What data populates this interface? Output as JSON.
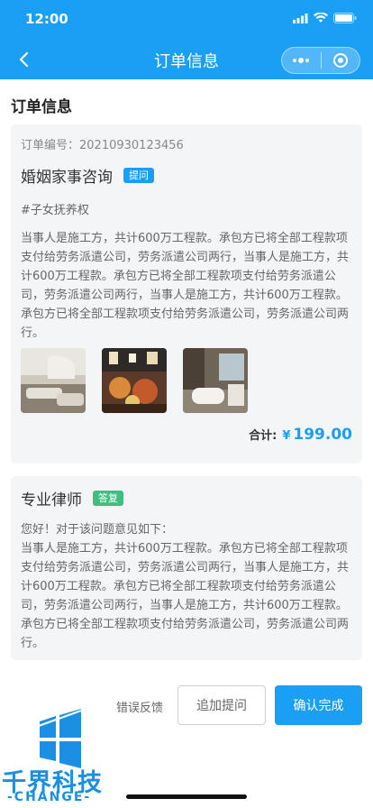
{
  "status": {
    "time": "12:00"
  },
  "nav": {
    "title": "订单信息"
  },
  "section": {
    "title": "订单信息"
  },
  "order": {
    "number_text": "订单编号：20210930123456",
    "category": "婚姻家事咨询",
    "badge": "提问",
    "tag": "#子女抚养权",
    "content": "当事人是施工方，共计600万工程款。承包方已将全部工程款项支付给劳务派遣公司，劳务派遣公司两行，当事人是施工方，共计600万工程款。承包方已将全部工程款项支付给劳务派遣公司，劳务派遣公司两行，当事人是施工方，共计600万工程款。承包方已将全部工程款项支付给劳务派遣公司，劳务派遣公司两行。",
    "total_label": "合计:",
    "currency": "¥",
    "amount": "199.00"
  },
  "answer": {
    "title": "专业律师",
    "badge": "答复",
    "greeting": "您好！对于该问题意见如下：",
    "content": "当事人是施工方，共计600万工程款。承包方已将全部工程款项支付给劳务派遣公司，劳务派遣公司两行，当事人是施工方，共计600万工程款。承包方已将全部工程款项支付给劳务派遣公司，劳务派遣公司两行，当事人是施工方，共计600万工程款。承包方已将全部工程款项支付给劳务派遣公司，劳务派遣公司两行。"
  },
  "actions": {
    "feedback": "错误反馈",
    "add_question": "追加提问",
    "confirm": "确认完成"
  },
  "watermark": {
    "text": "千界科技",
    "sub": "-CHANGE-"
  },
  "colors": {
    "primary": "#1a9ff5",
    "green": "#3fbf7f",
    "card": "#f4f5f7"
  }
}
